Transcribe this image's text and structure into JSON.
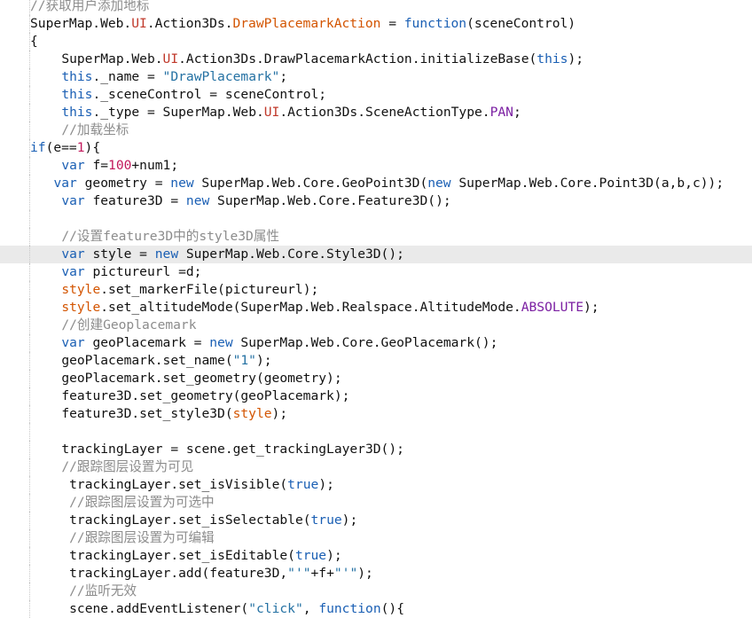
{
  "editor": {
    "current_line_index": 14,
    "lines": [
      {
        "indent": 4,
        "tokens": [
          {
            "t": "//获取用户添加地标",
            "k": "com"
          }
        ]
      },
      {
        "indent": 4,
        "tokens": [
          {
            "t": "SuperMap.Web.",
            "k": "txt"
          },
          {
            "t": "UI",
            "k": "ns"
          },
          {
            "t": ".Action3Ds.",
            "k": "txt"
          },
          {
            "t": "DrawPlacemarkAction",
            "k": "fn"
          },
          {
            "t": " = ",
            "k": "txt"
          },
          {
            "t": "function",
            "k": "kw"
          },
          {
            "t": "(sceneControl)",
            "k": "txt"
          }
        ]
      },
      {
        "indent": 4,
        "tokens": [
          {
            "t": "{",
            "k": "txt"
          }
        ]
      },
      {
        "indent": 8,
        "tokens": [
          {
            "t": "SuperMap.Web.",
            "k": "txt"
          },
          {
            "t": "UI",
            "k": "ns"
          },
          {
            "t": ".Action3Ds.DrawPlacemarkAction.initializeBase(",
            "k": "txt"
          },
          {
            "t": "this",
            "k": "kw"
          },
          {
            "t": ");",
            "k": "txt"
          }
        ]
      },
      {
        "indent": 8,
        "tokens": [
          {
            "t": "this",
            "k": "kw"
          },
          {
            "t": "._name = ",
            "k": "txt"
          },
          {
            "t": "\"DrawPlacemark\"",
            "k": "str"
          },
          {
            "t": ";",
            "k": "txt"
          }
        ]
      },
      {
        "indent": 8,
        "tokens": [
          {
            "t": "this",
            "k": "kw"
          },
          {
            "t": "._sceneControl = sceneControl;",
            "k": "txt"
          }
        ]
      },
      {
        "indent": 8,
        "tokens": [
          {
            "t": "this",
            "k": "kw"
          },
          {
            "t": "._type = SuperMap.Web.",
            "k": "txt"
          },
          {
            "t": "UI",
            "k": "ns"
          },
          {
            "t": ".Action3Ds.SceneActionType.",
            "k": "txt"
          },
          {
            "t": "PAN",
            "k": "const"
          },
          {
            "t": ";",
            "k": "txt"
          }
        ]
      },
      {
        "indent": 8,
        "tokens": [
          {
            "t": "//加载坐标",
            "k": "com"
          }
        ]
      },
      {
        "indent": 4,
        "tokens": [
          {
            "t": "if",
            "k": "kw"
          },
          {
            "t": "(e==",
            "k": "txt"
          },
          {
            "t": "1",
            "k": "num"
          },
          {
            "t": "){",
            "k": "txt"
          }
        ]
      },
      {
        "indent": 8,
        "tokens": [
          {
            "t": "var",
            "k": "kw"
          },
          {
            "t": " f=",
            "k": "txt"
          },
          {
            "t": "100",
            "k": "num"
          },
          {
            "t": "+num1;",
            "k": "txt"
          }
        ]
      },
      {
        "indent": 7,
        "tokens": [
          {
            "t": "var",
            "k": "kw"
          },
          {
            "t": " geometry = ",
            "k": "txt"
          },
          {
            "t": "new",
            "k": "kw"
          },
          {
            "t": " SuperMap.Web.Core.GeoPoint3D(",
            "k": "txt"
          },
          {
            "t": "new",
            "k": "kw"
          },
          {
            "t": " SuperMap.Web.Core.Point3D(a,b,c));",
            "k": "txt"
          }
        ]
      },
      {
        "indent": 8,
        "tokens": [
          {
            "t": "var",
            "k": "kw"
          },
          {
            "t": " feature3D = ",
            "k": "txt"
          },
          {
            "t": "new",
            "k": "kw"
          },
          {
            "t": " SuperMap.Web.Core.Feature3D();",
            "k": "txt"
          }
        ]
      },
      {
        "indent": 0,
        "tokens": []
      },
      {
        "indent": 8,
        "tokens": [
          {
            "t": "//设置feature3D中的style3D属性",
            "k": "com"
          }
        ]
      },
      {
        "indent": 8,
        "tokens": [
          {
            "t": "var",
            "k": "kw"
          },
          {
            "t": " style = ",
            "k": "txt"
          },
          {
            "t": "new",
            "k": "kw"
          },
          {
            "t": " SuperMap.Web.Core.Style3D();",
            "k": "txt"
          }
        ]
      },
      {
        "indent": 8,
        "tokens": [
          {
            "t": "var",
            "k": "kw"
          },
          {
            "t": " pictureurl =d;",
            "k": "txt"
          }
        ]
      },
      {
        "indent": 8,
        "tokens": [
          {
            "t": "style",
            "k": "fn"
          },
          {
            "t": ".set_markerFile(pictureurl);",
            "k": "txt"
          }
        ]
      },
      {
        "indent": 8,
        "tokens": [
          {
            "t": "style",
            "k": "fn"
          },
          {
            "t": ".set_altitudeMode(SuperMap.Web.Realspace.AltitudeMode.",
            "k": "txt"
          },
          {
            "t": "ABSOLUTE",
            "k": "const"
          },
          {
            "t": ");",
            "k": "txt"
          }
        ]
      },
      {
        "indent": 8,
        "tokens": [
          {
            "t": "//创建Geoplacemark",
            "k": "com"
          }
        ]
      },
      {
        "indent": 8,
        "tokens": [
          {
            "t": "var",
            "k": "kw"
          },
          {
            "t": " geoPlacemark = ",
            "k": "txt"
          },
          {
            "t": "new",
            "k": "kw"
          },
          {
            "t": " SuperMap.Web.Core.GeoPlacemark();",
            "k": "txt"
          }
        ]
      },
      {
        "indent": 8,
        "tokens": [
          {
            "t": "geoPlacemark.set_name(",
            "k": "txt"
          },
          {
            "t": "\"1\"",
            "k": "str"
          },
          {
            "t": ");",
            "k": "txt"
          }
        ]
      },
      {
        "indent": 8,
        "tokens": [
          {
            "t": "geoPlacemark.set_geometry(geometry);",
            "k": "txt"
          }
        ]
      },
      {
        "indent": 8,
        "tokens": [
          {
            "t": "feature3D.set_geometry(geoPlacemark);",
            "k": "txt"
          }
        ]
      },
      {
        "indent": 8,
        "tokens": [
          {
            "t": "feature3D.set_style3D(",
            "k": "txt"
          },
          {
            "t": "style",
            "k": "fn"
          },
          {
            "t": ");",
            "k": "txt"
          }
        ]
      },
      {
        "indent": 0,
        "tokens": []
      },
      {
        "indent": 8,
        "tokens": [
          {
            "t": "trackingLayer = scene.get_trackingLayer3D();",
            "k": "txt"
          }
        ]
      },
      {
        "indent": 8,
        "tokens": [
          {
            "t": "//跟踪图层设置为可见",
            "k": "com"
          }
        ]
      },
      {
        "indent": 9,
        "tokens": [
          {
            "t": "trackingLayer.set_isVisible(",
            "k": "txt"
          },
          {
            "t": "true",
            "k": "kw"
          },
          {
            "t": ");",
            "k": "txt"
          }
        ]
      },
      {
        "indent": 9,
        "tokens": [
          {
            "t": "//跟踪图层设置为可选中",
            "k": "com"
          }
        ]
      },
      {
        "indent": 9,
        "tokens": [
          {
            "t": "trackingLayer.set_isSelectable(",
            "k": "txt"
          },
          {
            "t": "true",
            "k": "kw"
          },
          {
            "t": ");",
            "k": "txt"
          }
        ]
      },
      {
        "indent": 9,
        "tokens": [
          {
            "t": "//跟踪图层设置为可编辑",
            "k": "com"
          }
        ]
      },
      {
        "indent": 9,
        "tokens": [
          {
            "t": "trackingLayer.set_isEditable(",
            "k": "txt"
          },
          {
            "t": "true",
            "k": "kw"
          },
          {
            "t": ");",
            "k": "txt"
          }
        ]
      },
      {
        "indent": 9,
        "tokens": [
          {
            "t": "trackingLayer.add(feature3D,",
            "k": "txt"
          },
          {
            "t": "\"'\"",
            "k": "str"
          },
          {
            "t": "+f+",
            "k": "txt"
          },
          {
            "t": "\"'\"",
            "k": "str"
          },
          {
            "t": ");",
            "k": "txt"
          }
        ]
      },
      {
        "indent": 9,
        "tokens": [
          {
            "t": "//监听无效",
            "k": "com"
          }
        ]
      },
      {
        "indent": 9,
        "tokens": [
          {
            "t": "scene.addEventListener(",
            "k": "txt"
          },
          {
            "t": "\"click\"",
            "k": "str"
          },
          {
            "t": ", ",
            "k": "txt"
          },
          {
            "t": "function",
            "k": "kw"
          },
          {
            "t": "(){",
            "k": "txt"
          }
        ]
      }
    ]
  }
}
